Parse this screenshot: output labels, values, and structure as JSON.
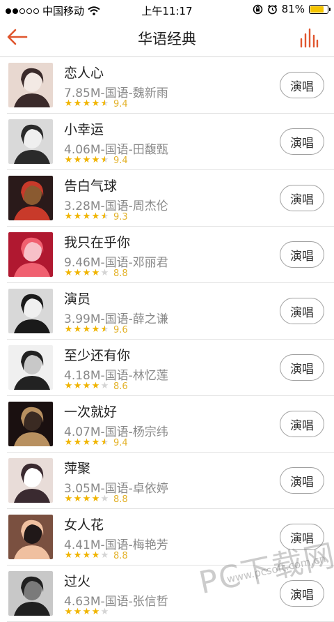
{
  "status_bar": {
    "carrier": "中国移动",
    "time": "上午11:17",
    "battery_percent": "81%",
    "battery_level": 0.81
  },
  "nav": {
    "title": "华语经典",
    "back_icon": "arrow-left-icon",
    "equalizer_icon": "equalizer-icon",
    "accent_color": "#e0562e"
  },
  "songs": [
    {
      "title": "恋人心",
      "meta": "7.85M-国语-魏新雨",
      "rating": 4.5,
      "score": "9.4",
      "sing_label": "演唱"
    },
    {
      "title": "小幸运",
      "meta": "4.06M-国语-田馥甄",
      "rating": 4.5,
      "score": "9.4",
      "sing_label": "演唱"
    },
    {
      "title": "告白气球",
      "meta": "3.28M-国语-周杰伦",
      "rating": 4.5,
      "score": "9.3",
      "sing_label": "演唱"
    },
    {
      "title": "我只在乎你",
      "meta": "9.46M-国语-邓丽君",
      "rating": 4,
      "score": "8.8",
      "sing_label": "演唱"
    },
    {
      "title": "演员",
      "meta": "3.99M-国语-薛之谦",
      "rating": 4.5,
      "score": "9.6",
      "sing_label": "演唱"
    },
    {
      "title": "至少还有你",
      "meta": "4.18M-国语-林忆莲",
      "rating": 4,
      "score": "8.6",
      "sing_label": "演唱"
    },
    {
      "title": "一次就好",
      "meta": "4.07M-国语-杨宗纬",
      "rating": 4.5,
      "score": "9.4",
      "sing_label": "演唱"
    },
    {
      "title": "萍聚",
      "meta": "3.05M-国语-卓依婷",
      "rating": 4,
      "score": "8.8",
      "sing_label": "演唱"
    },
    {
      "title": "女人花",
      "meta": "4.41M-国语-梅艳芳",
      "rating": 4,
      "score": "8.8",
      "sing_label": "演唱"
    },
    {
      "title": "过火",
      "meta": "4.63M-国语-张信哲",
      "rating": 4,
      "score": "",
      "sing_label": "演唱"
    }
  ],
  "watermark": {
    "text": "PC下载网",
    "url": "www.pcsoft.com.cn"
  }
}
